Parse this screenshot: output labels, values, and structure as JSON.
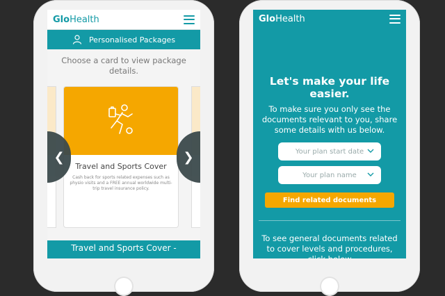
{
  "left": {
    "brand_bold": "Glo",
    "brand_rest": "Health",
    "package_bar_label": "Personalised Packages",
    "hint": "Choose a card to view package details.",
    "card": {
      "title": "Travel and Sports Cover",
      "description": "Cash back for sports related expenses such as physio visits and a FREE annual worldwide multi-trip travel insurance policy."
    },
    "prev_arrow": "❮",
    "next_arrow": "❯",
    "footer_title": "Travel and Sports Cover -"
  },
  "right": {
    "brand_bold": "Glo",
    "brand_rest": "Health",
    "headline": "Let's make your life easier.",
    "subtext": "To make sure you only see the documents relevant to you, share some details with us below.",
    "start_date_placeholder": "Your plan start date",
    "plan_name_placeholder": "Your plan name",
    "find_button": "Find related documents",
    "bottom_text": "To see general documents related to cover levels and procedures, click below"
  },
  "colors": {
    "teal": "#139aa6",
    "orange": "#f5a700"
  }
}
